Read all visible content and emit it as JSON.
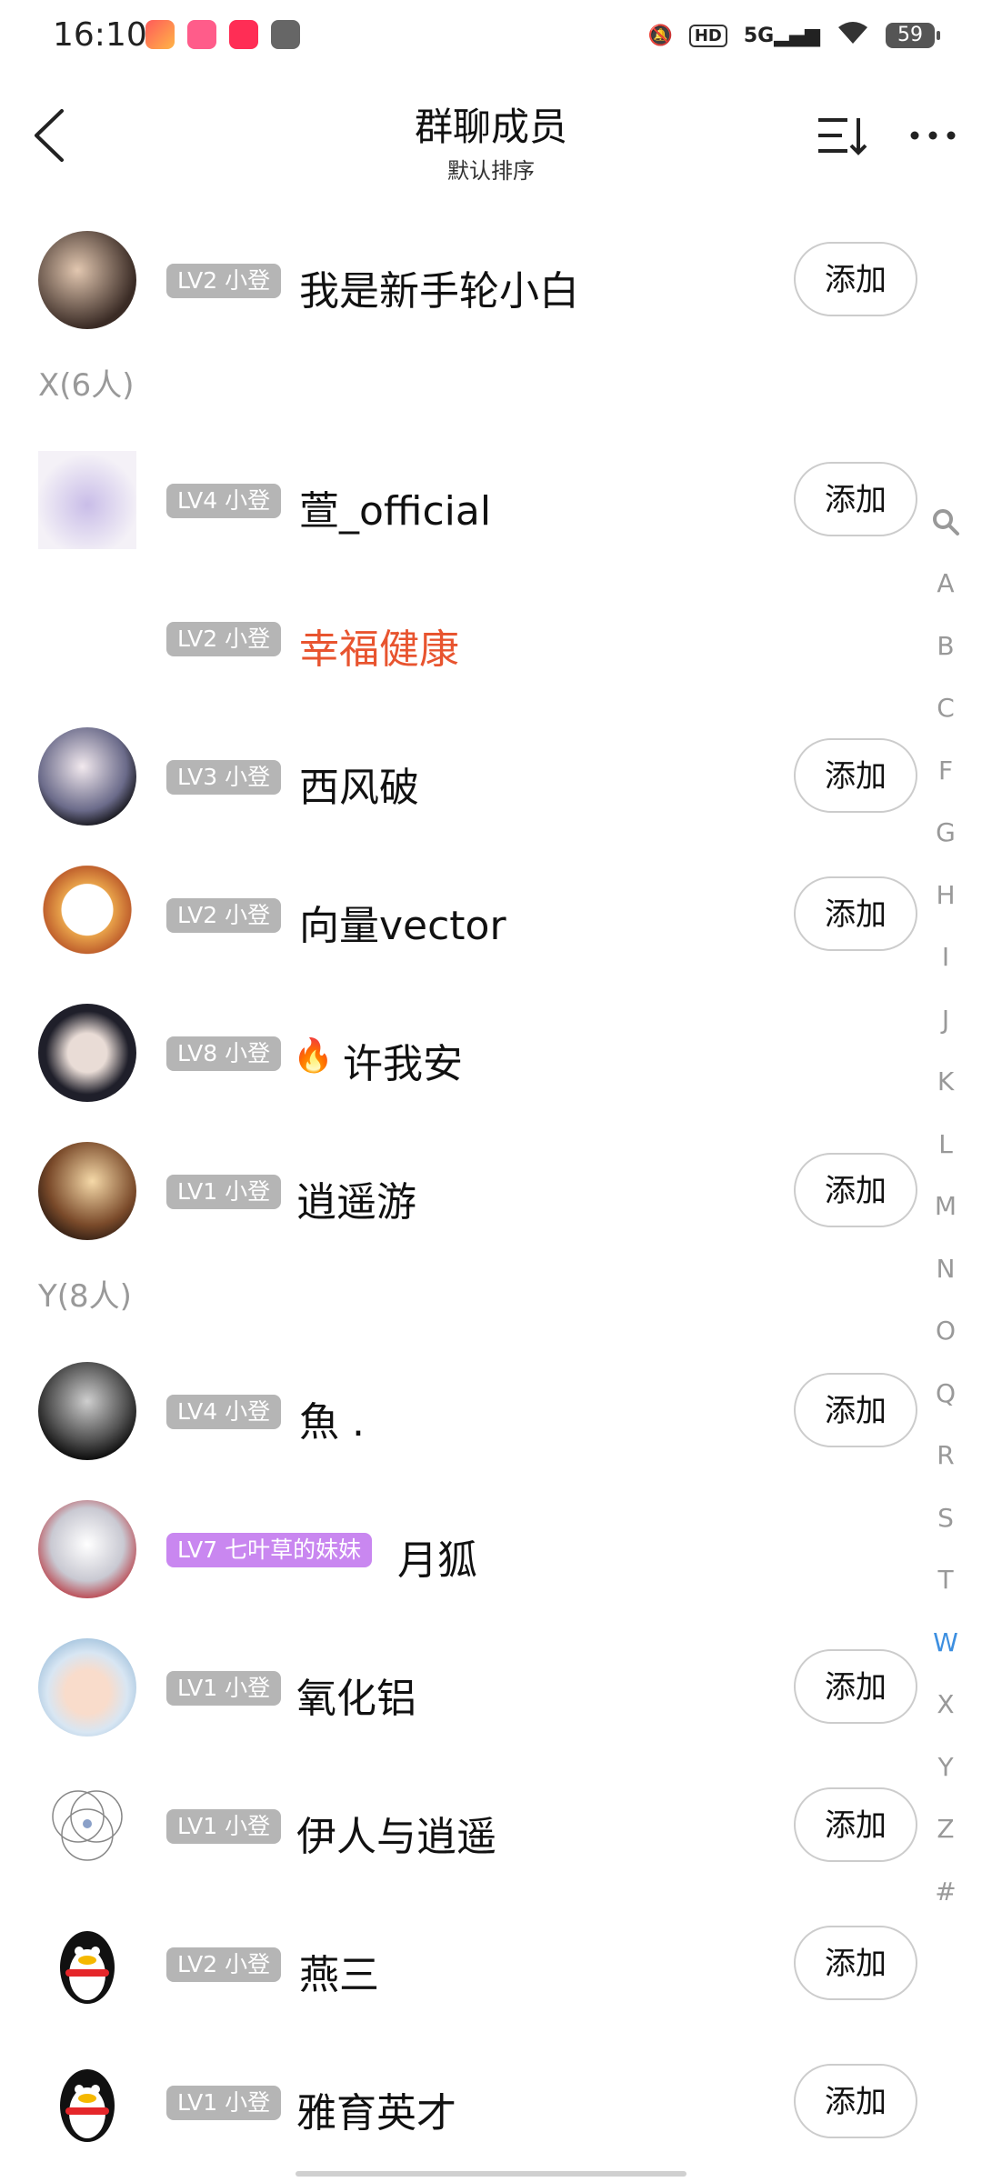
{
  "status_bar": {
    "time": "16:10",
    "network": "5G",
    "hd_label": "HD",
    "battery": "59"
  },
  "header": {
    "title": "群聊成员",
    "subtitle": "默认排序"
  },
  "first_member": {
    "level": "LV2 小登",
    "name": "我是新手轮小白",
    "add_label": "添加"
  },
  "sections": [
    {
      "header": "X(6人)",
      "members": [
        {
          "level": "LV4 小登",
          "name": "萱_official",
          "add_label": "添加"
        },
        {
          "level": "LV2 小登",
          "name": "幸福健康",
          "add_label": ""
        },
        {
          "level": "LV3 小登",
          "name": "西风破",
          "add_label": "添加"
        },
        {
          "level": "LV2 小登",
          "name": "向量vector",
          "add_label": "添加"
        },
        {
          "level": "LV8 小登",
          "name": "许我安",
          "add_label": ""
        },
        {
          "level": "LV1 小登",
          "name": "逍遥游",
          "add_label": "添加"
        }
      ]
    },
    {
      "header": "Y(8人)",
      "members": [
        {
          "level": "LV4 小登",
          "name": "魚 .",
          "add_label": "添加"
        },
        {
          "level": "LV7 七叶草的妹妹",
          "name": "月狐",
          "add_label": ""
        },
        {
          "level": "LV1 小登",
          "name": "氧化铝",
          "add_label": "添加"
        },
        {
          "level": "LV1 小登",
          "name": "伊人与逍遥",
          "add_label": "添加"
        },
        {
          "level": "LV2 小登",
          "name": "燕三",
          "add_label": "添加"
        },
        {
          "level": "LV1 小登",
          "name": "雅育英才",
          "add_label": "添加"
        }
      ]
    }
  ],
  "index_letters": [
    "A",
    "B",
    "C",
    "F",
    "G",
    "H",
    "I",
    "J",
    "K",
    "L",
    "M",
    "N",
    "O",
    "Q",
    "R",
    "S",
    "T",
    "W",
    "X",
    "Y",
    "Z",
    "#"
  ],
  "index_active": "W",
  "colors": {
    "accent": "#3d8fe0",
    "badge_gray": "#b5b5b5",
    "badge_purple": "#c987f0",
    "highlight_name": "#e8542f"
  }
}
